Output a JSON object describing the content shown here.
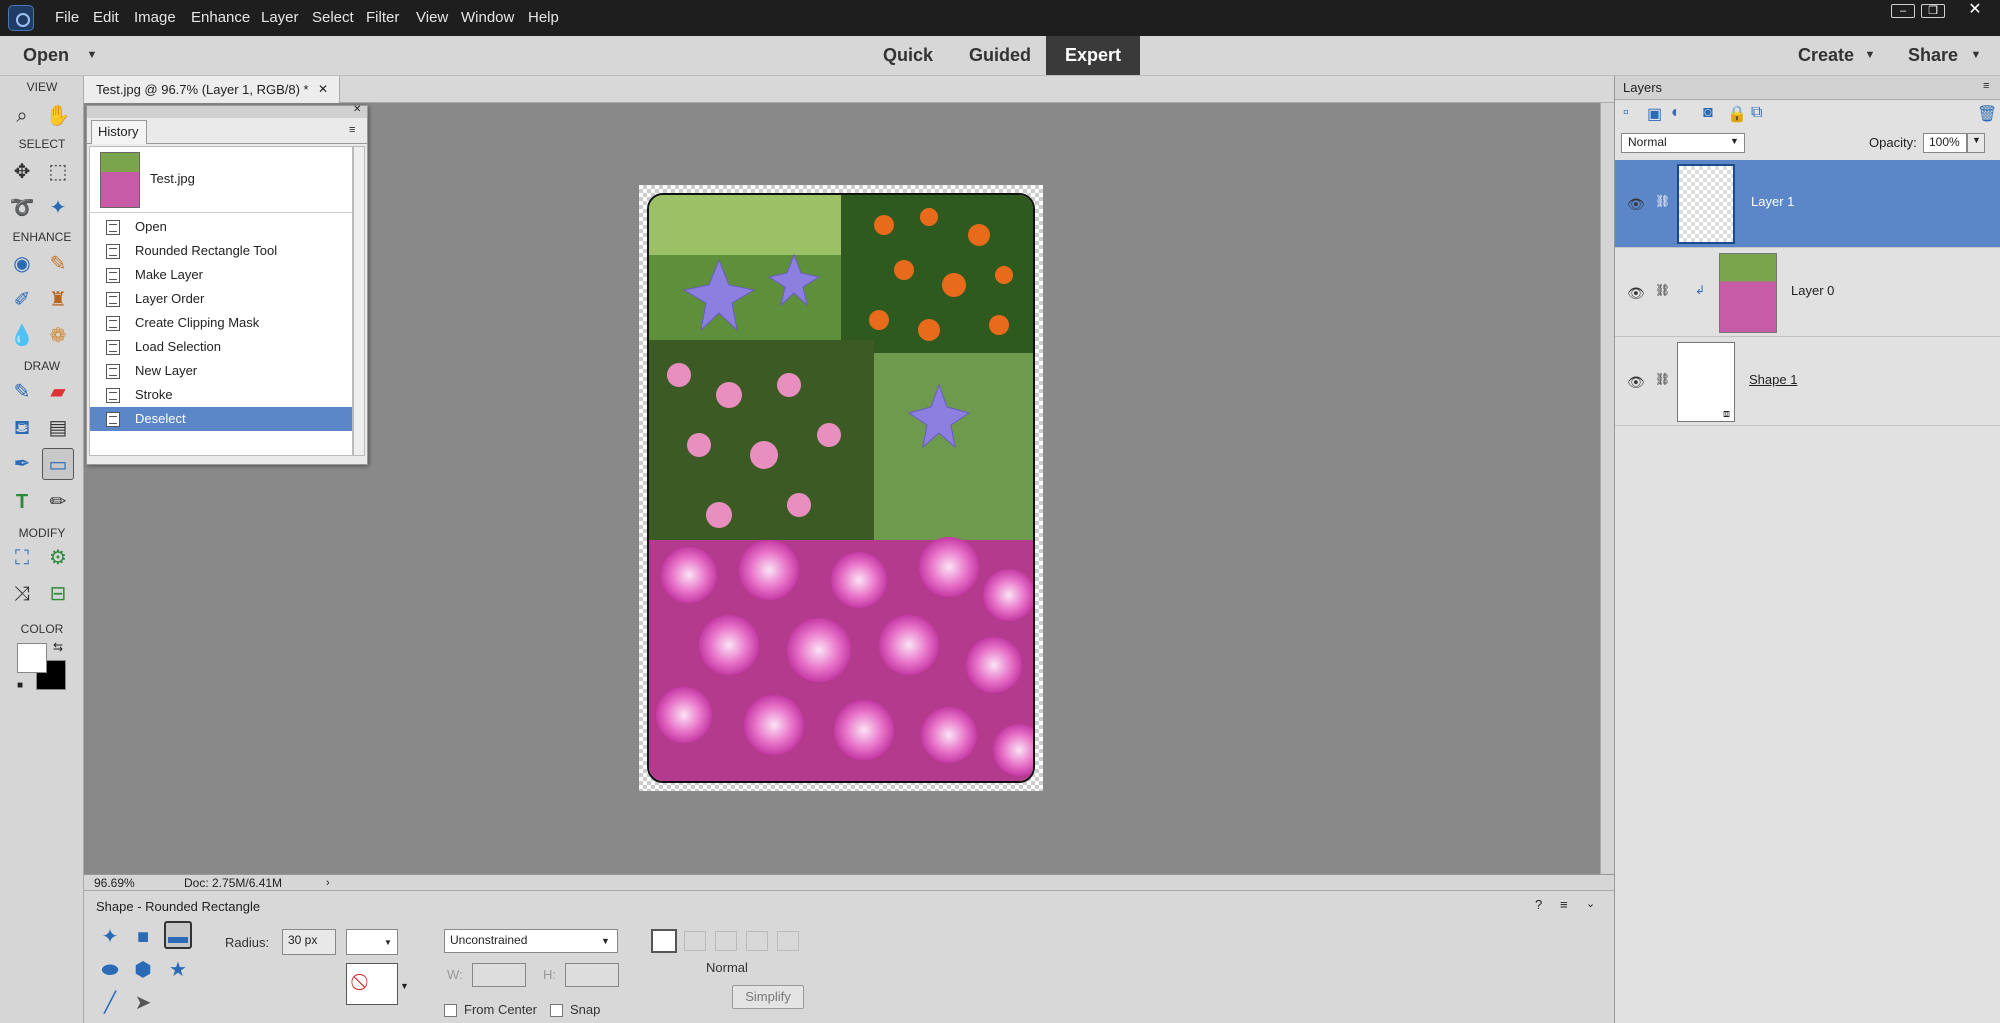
{
  "menubar": {
    "items": [
      "File",
      "Edit",
      "Image",
      "Enhance",
      "Layer",
      "Select",
      "Filter",
      "View",
      "Window",
      "Help"
    ]
  },
  "modebar": {
    "open_label": "Open",
    "modes": [
      "Quick",
      "Guided",
      "Expert"
    ],
    "active_mode": "Expert",
    "create_label": "Create",
    "share_label": "Share"
  },
  "toolbox": {
    "sections": [
      "VIEW",
      "SELECT",
      "ENHANCE",
      "DRAW",
      "MODIFY",
      "COLOR"
    ],
    "tools": [
      "zoom-tool-icon",
      "hand-tool-icon",
      "move-tool-icon",
      "marquee-tool-icon",
      "lasso-tool-icon",
      "magic-wand-icon",
      "red-eye-icon",
      "spot-healing-icon",
      "smart-brush-icon",
      "clone-stamp-icon",
      "blur-icon",
      "sponge-icon",
      "brush-icon",
      "eraser-icon",
      "paint-bucket-icon",
      "gradient-icon",
      "eyedropper-icon",
      "shape-tool-icon",
      "type-tool-icon",
      "pencil-icon",
      "crop-icon",
      "recompose-icon",
      "content-move-icon",
      "straighten-icon"
    ]
  },
  "document": {
    "tab_title": "Test.jpg @ 96.7% (Layer 1, RGB/8) *",
    "zoom": "96.69%",
    "doc_size": "Doc: 2.75M/6.41M"
  },
  "history": {
    "tab_label": "History",
    "snapshot_label": "Test.jpg",
    "steps": [
      "Open",
      "Rounded Rectangle Tool",
      "Make Layer",
      "Layer Order",
      "Create Clipping Mask",
      "Load Selection",
      "New Layer",
      "Stroke",
      "Deselect"
    ],
    "selected_step": "Deselect"
  },
  "layers": {
    "tab_label": "Layers",
    "blend_mode": "Normal",
    "opacity_label": "Opacity:",
    "opacity_value": "100%",
    "items": [
      {
        "name": "Layer 1",
        "selected": true
      },
      {
        "name": "Layer 0",
        "selected": false
      },
      {
        "name": "Shape 1",
        "selected": false
      }
    ]
  },
  "options": {
    "tool_title": "Shape - Rounded Rectangle",
    "radius_label": "Radius:",
    "radius_value": "30 px",
    "constraint": "Unconstrained",
    "w_label": "W:",
    "h_label": "H:",
    "from_center_label": "From Center",
    "snap_label": "Snap",
    "mode_label": "Normal",
    "simplify_label": "Simplify"
  },
  "colors": {
    "selection": "#5b86c8",
    "accent": "#2b6bb6"
  }
}
